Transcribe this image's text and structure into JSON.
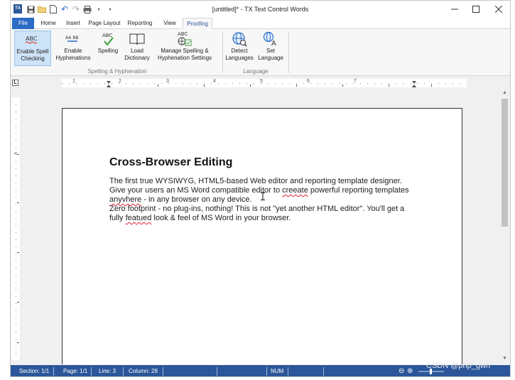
{
  "titlebar": {
    "app_icon": "TX",
    "title": "[untitled]* - TX Text Control Words",
    "quick_access": [
      "save-icon",
      "open-folder-icon",
      "new-document-icon",
      "undo-icon",
      "redo-icon",
      "print-icon",
      "customize-dropdown-icon"
    ]
  },
  "tabs": [
    "File",
    "Home",
    "Insert",
    "Page Layout",
    "Reporting",
    "View",
    "Proofing"
  ],
  "active_tab": "Proofing",
  "ribbon": {
    "groups": [
      {
        "label": "Spelling & Hyphenation",
        "buttons": [
          {
            "line1": "Enable Spell",
            "line2": "Checking",
            "icon": "spell-check-icon"
          },
          {
            "line1": "Enable",
            "line2": "Hyphenations",
            "icon": "hyphenation-icon"
          },
          {
            "line1": "Spelling",
            "line2": "",
            "icon": "spelling-icon"
          },
          {
            "line1": "Load",
            "line2": "Dictionary",
            "icon": "dictionary-icon"
          },
          {
            "line1": "Manage Spelling &",
            "line2": "Hyphenation Settings",
            "icon": "spelling-settings-icon"
          }
        ]
      },
      {
        "label": "Language",
        "buttons": [
          {
            "line1": "Detect",
            "line2": "Languages",
            "icon": "detect-language-icon"
          },
          {
            "line1": "Set",
            "line2": "Language",
            "icon": "set-language-icon"
          }
        ]
      }
    ]
  },
  "ruler": {
    "numbers": [
      "1",
      "2",
      "3",
      "4",
      "5",
      "6",
      "7"
    ],
    "corner": "L"
  },
  "document": {
    "heading": "Cross-Browser Editing",
    "lines": [
      "The first true WYSIWYG, HTML5-based Web editor and reporting template designer.",
      "Give your users an MS Word compatible editor to creeate powerful reporting templates",
      "anyvhere - in any browser on any device.",
      "Zero footprint - no plug-ins, nothing! This is not \"yet another HTML editor\". You'll get a",
      "fully featued look & feel of MS Word in your browser."
    ],
    "misspelled_words": [
      "creeate",
      "anyvhere",
      "featued"
    ]
  },
  "statusbar": {
    "section": "Section: 1/1",
    "page": "Page: 1/1",
    "line": "Line: 3",
    "column": "Column: 28",
    "num": "NUM",
    "zoom_icons": [
      "zoom-out-icon",
      "zoom-in-icon"
    ]
  },
  "watermark": "CSDN @php_gwn"
}
